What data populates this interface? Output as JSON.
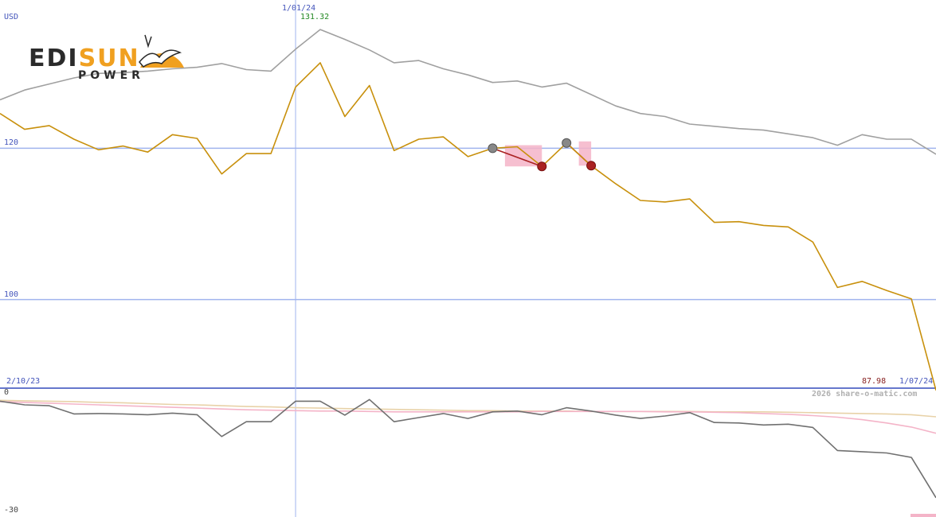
{
  "currency": "USD",
  "logo": {
    "part1": "EDI",
    "part2": "SUN",
    "sub": "POWER",
    "color_dark": "#2b2b2b",
    "color_accent": "#f0a020"
  },
  "labels": {
    "start_date": "2/10/23",
    "end_date": "1/07/24",
    "cursor_date": "1/01/24",
    "cursor_value": "131.32",
    "last_value": "87.98",
    "copyright": "2026 share-o-matic.com"
  },
  "colors": {
    "price": "#c8900c",
    "compare": "#a0a0a0",
    "grid": "#a0b4ee",
    "axis_label": "#4455bb",
    "cursor_value": "#228822",
    "last_value": "#882222",
    "osc_dark": "#707070",
    "osc_pink": "#f4b4c8",
    "osc_tan": "#e8d2a8",
    "signal_red": "#aa2222"
  },
  "chart_data": [
    {
      "type": "line",
      "y_unit": "USD",
      "ylim": [
        88.5,
        139.6
      ],
      "y_ticks": [
        100,
        120
      ],
      "grid": "horizontal at ticks",
      "x": [
        "2/10/23",
        "1/07/24"
      ],
      "cursor_index": 12,
      "series": [
        {
          "role": "price",
          "values": [
            124.6,
            122.5,
            123.0,
            121.2,
            119.8,
            120.3,
            119.5,
            121.8,
            121.3,
            116.6,
            119.3,
            119.3,
            128.1,
            131.3,
            124.2,
            128.3,
            119.7,
            121.2,
            121.5,
            118.9,
            120.0,
            120.2,
            117.6,
            120.7,
            117.7,
            115.3,
            113.1,
            112.9,
            113.3,
            110.2,
            110.3,
            109.8,
            109.6,
            107.6,
            101.6,
            102.4,
            101.2,
            100.1,
            88.0
          ]
        },
        {
          "role": "comparison",
          "values": [
            126.4,
            127.7,
            128.5,
            129.3,
            129.9,
            130.0,
            130.2,
            130.5,
            130.7,
            131.2,
            130.4,
            130.2,
            133.1,
            135.7,
            134.4,
            133.0,
            131.3,
            131.6,
            130.5,
            129.7,
            128.7,
            128.9,
            128.1,
            128.6,
            127.1,
            125.6,
            124.6,
            124.2,
            123.2,
            122.9,
            122.6,
            122.4,
            121.9,
            121.4,
            120.4,
            121.8,
            121.2,
            121.2,
            119.2
          ]
        }
      ],
      "signals": [
        {
          "type": "buy",
          "index": 20
        },
        {
          "type": "sell",
          "index": 22
        },
        {
          "type": "buy",
          "index": 23
        },
        {
          "type": "sell",
          "index": 24
        }
      ]
    },
    {
      "type": "line",
      "ylim": [
        -30,
        0
      ],
      "y_ticks": [
        0,
        -30
      ],
      "series": [
        {
          "role": "oscillator",
          "values": [
            -2.2,
            -3.1,
            -3.3,
            -5.3,
            -5.2,
            -5.3,
            -5.5,
            -5.1,
            -5.5,
            -10.8,
            -7.2,
            -7.2,
            -2.2,
            -2.2,
            -5.6,
            -1.8,
            -7.2,
            -6.2,
            -5.2,
            -6.4,
            -4.8,
            -4.6,
            -5.5,
            -3.8,
            -4.6,
            -5.6,
            -6.4,
            -5.8,
            -5.0,
            -7.4,
            -7.5,
            -8.0,
            -7.8,
            -8.6,
            -14.2,
            -14.5,
            -14.8,
            -15.9,
            -25.7
          ]
        },
        {
          "role": "average-pink",
          "values": [
            -2.3,
            -2.5,
            -2.7,
            -2.9,
            -3.1,
            -3.3,
            -3.5,
            -3.7,
            -3.9,
            -4.1,
            -4.3,
            -4.4,
            -4.5,
            -4.6,
            -4.6,
            -4.7,
            -4.8,
            -4.8,
            -4.8,
            -4.8,
            -4.8,
            -4.8,
            -4.7,
            -4.7,
            -4.7,
            -4.7,
            -4.7,
            -4.8,
            -4.8,
            -4.9,
            -5.0,
            -5.2,
            -5.4,
            -5.7,
            -6.1,
            -6.7,
            -7.5,
            -8.5,
            -10.0
          ]
        },
        {
          "role": "average-tan",
          "values": [
            -2.0,
            -2.1,
            -2.2,
            -2.3,
            -2.5,
            -2.6,
            -2.8,
            -3.0,
            -3.1,
            -3.3,
            -3.5,
            -3.6,
            -3.8,
            -3.9,
            -4.0,
            -4.1,
            -4.2,
            -4.3,
            -4.4,
            -4.5,
            -4.5,
            -4.6,
            -4.6,
            -4.6,
            -4.7,
            -4.7,
            -4.7,
            -4.7,
            -4.7,
            -4.8,
            -4.8,
            -4.8,
            -4.9,
            -5.0,
            -5.1,
            -5.2,
            -5.3,
            -5.5,
            -6.0
          ]
        }
      ]
    }
  ]
}
